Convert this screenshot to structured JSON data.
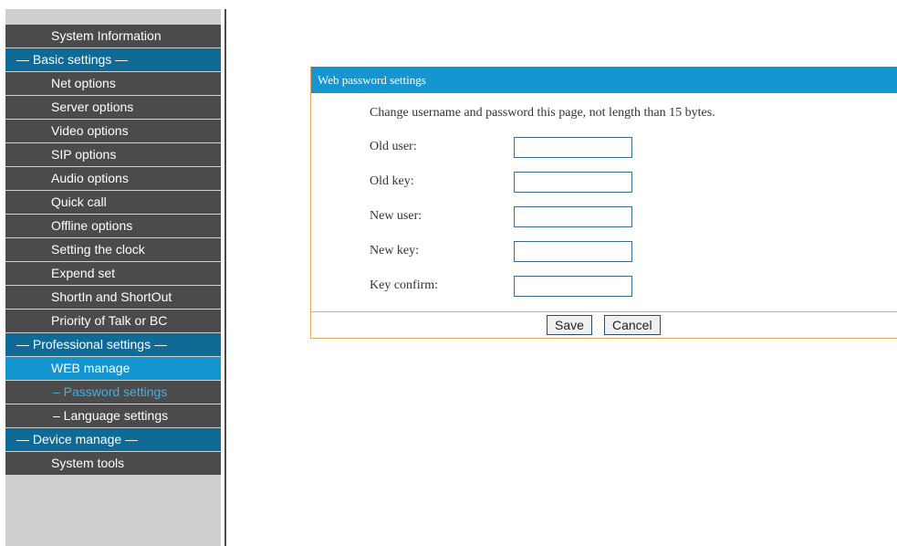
{
  "sidebar": {
    "items": [
      {
        "label": "System Information",
        "kind": "normal"
      },
      {
        "label": "— Basic settings —",
        "kind": "section"
      },
      {
        "label": "Net options",
        "kind": "normal"
      },
      {
        "label": "Server options",
        "kind": "normal"
      },
      {
        "label": "Video options",
        "kind": "normal"
      },
      {
        "label": "SIP options",
        "kind": "normal"
      },
      {
        "label": "Audio options",
        "kind": "normal"
      },
      {
        "label": "Quick call",
        "kind": "normal"
      },
      {
        "label": "Offline options",
        "kind": "normal"
      },
      {
        "label": "Setting the clock",
        "kind": "normal"
      },
      {
        "label": "Expend set",
        "kind": "normal"
      },
      {
        "label": "ShortIn and ShortOut",
        "kind": "normal"
      },
      {
        "label": "Priority of Talk or BC",
        "kind": "normal"
      },
      {
        "label": "— Professional settings —",
        "kind": "section"
      },
      {
        "label": "WEB manage",
        "kind": "active"
      },
      {
        "label": "– Password settings",
        "kind": "current"
      },
      {
        "label": "– Language settings",
        "kind": "sub"
      },
      {
        "label": "— Device manage —",
        "kind": "section"
      },
      {
        "label": "System tools",
        "kind": "normal"
      }
    ]
  },
  "panel": {
    "title": "Web password settings",
    "note": "Change username and password this page, not length than 15 bytes.",
    "fields": {
      "old_user": {
        "label": "Old user:",
        "value": ""
      },
      "old_key": {
        "label": "Old key:",
        "value": ""
      },
      "new_user": {
        "label": "New user:",
        "value": ""
      },
      "new_key": {
        "label": "New key:",
        "value": ""
      },
      "key_confirm": {
        "label": "Key confirm:",
        "value": ""
      }
    },
    "save_label": "Save",
    "cancel_label": "Cancel"
  },
  "colors": {
    "menu_normal": "#4b4b4b",
    "menu_section": "#0f6a96",
    "menu_active": "#1396d0",
    "menu_current_text": "#3fb1e6",
    "header": "#1596d1",
    "panel_border": "#e8a95f"
  }
}
